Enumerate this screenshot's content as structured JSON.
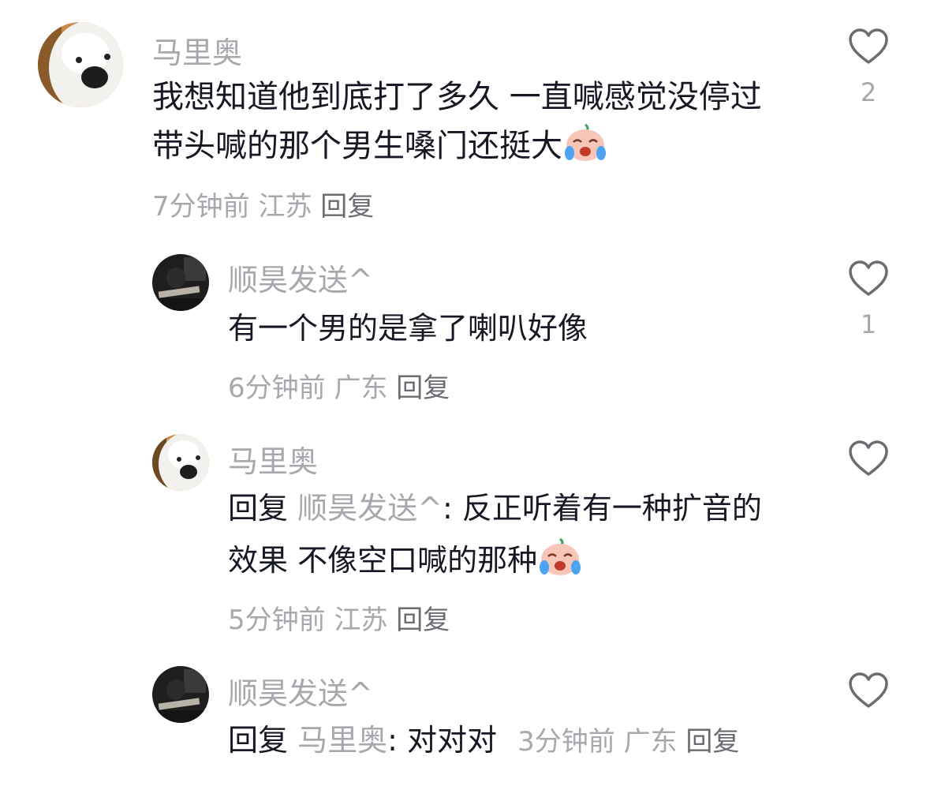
{
  "comments": [
    {
      "username": "马里奥",
      "lines": [
        "我想知道他到底打了多久 一直喊感觉没停过",
        "带头喊的那个男生嗓门还挺大"
      ],
      "emoji": "laugh-cry-emoji",
      "time": "7分钟前",
      "location": "江苏",
      "reply_label": "回复",
      "likes": "2"
    }
  ],
  "replies": [
    {
      "username": "顺昊发送^",
      "text": "有一个男的是拿了喇叭好像",
      "time": "6分钟前",
      "location": "广东",
      "reply_label": "回复",
      "likes": "1"
    },
    {
      "username": "马里奥",
      "reply_prefix": "回复",
      "reply_to": "顺昊发送^",
      "line1": ": 反正听着有一种扩音的",
      "line2": "效果 不像空口喊的那种",
      "emoji": "laugh-cry-emoji",
      "time": "5分钟前",
      "location": "江苏",
      "reply_label": "回复",
      "likes": ""
    },
    {
      "username": "顺昊发送^",
      "reply_prefix": "回复",
      "reply_to": "马里奥",
      "text": ": 对对对",
      "time": "3分钟前",
      "location": "广东",
      "reply_label": "回复",
      "likes": ""
    }
  ],
  "icons": {
    "like": "heart-outline-icon",
    "avatar_dog": "samoyed-avatar",
    "avatar_dark": "dark-photo-avatar"
  },
  "colors": {
    "text": "#161823",
    "muted": "#a7a8ad",
    "reply": "#6b6c72"
  }
}
